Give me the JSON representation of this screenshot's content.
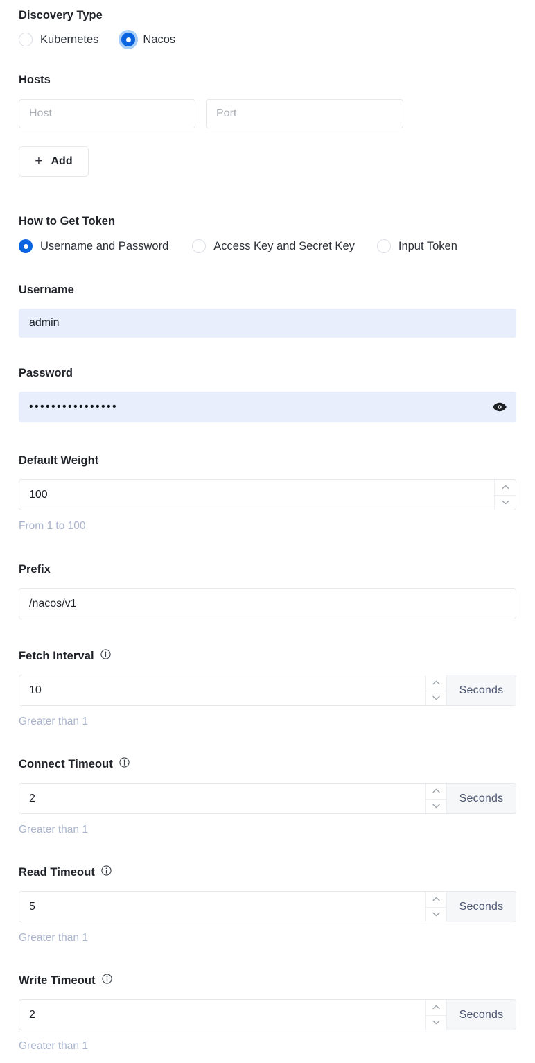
{
  "discovery": {
    "label": "Discovery Type",
    "options": [
      {
        "label": "Kubernetes",
        "selected": false
      },
      {
        "label": "Nacos",
        "selected": true
      }
    ]
  },
  "hosts": {
    "label": "Hosts",
    "host_placeholder": "Host",
    "host_value": "",
    "port_placeholder": "Port",
    "port_value": "",
    "add_label": "Add",
    "plus_glyph": "+"
  },
  "token": {
    "label": "How to Get Token",
    "options": [
      {
        "label": "Username and Password",
        "selected": true
      },
      {
        "label": "Access Key and Secret Key",
        "selected": false
      },
      {
        "label": "Input Token",
        "selected": false
      }
    ]
  },
  "username": {
    "label": "Username",
    "value": "admin"
  },
  "password": {
    "label": "Password",
    "masked_value": "••••••••••••••••",
    "reveal_icon": "eye-icon"
  },
  "default_weight": {
    "label": "Default Weight",
    "value": "100",
    "helper": "From 1 to 100"
  },
  "prefix": {
    "label": "Prefix",
    "value": "/nacos/v1"
  },
  "fetch_interval": {
    "label": "Fetch Interval",
    "info_icon": "info-icon",
    "value": "10",
    "unit": "Seconds",
    "helper": "Greater than 1"
  },
  "connect_timeout": {
    "label": "Connect Timeout",
    "info_icon": "info-icon",
    "value": "2",
    "unit": "Seconds",
    "helper": "Greater than 1"
  },
  "read_timeout": {
    "label": "Read Timeout",
    "info_icon": "info-icon",
    "value": "5",
    "unit": "Seconds",
    "helper": "Greater than 1"
  },
  "write_timeout": {
    "label": "Write Timeout",
    "info_icon": "info-icon",
    "value": "2",
    "unit": "Seconds",
    "helper": "Greater than 1"
  },
  "colors": {
    "accent": "#0a64e0",
    "autofill_bg": "#e8eefb",
    "helper_text": "#aab4cd",
    "unit_bg": "#f6f7f9",
    "unit_text": "#4c5670",
    "border": "#e6e8eb"
  }
}
